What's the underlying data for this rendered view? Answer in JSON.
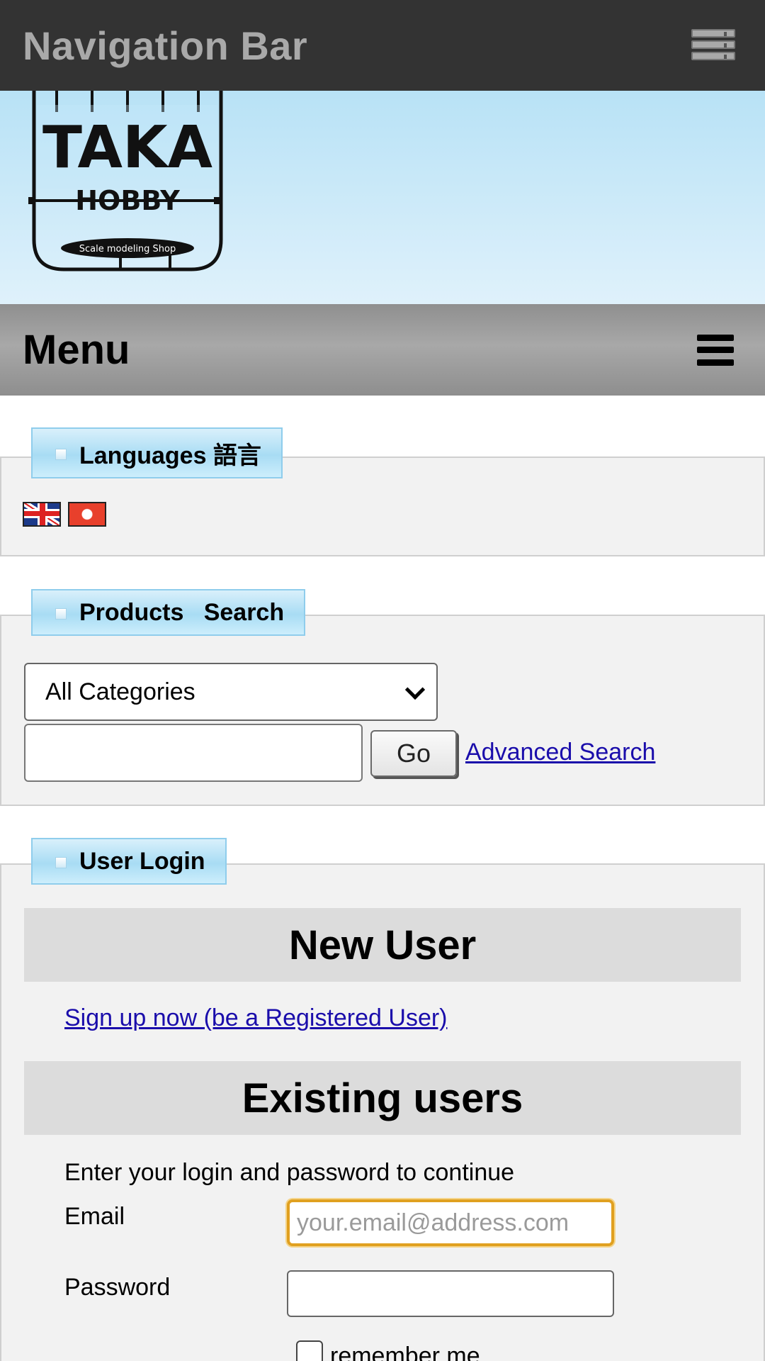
{
  "navbar": {
    "title": "Navigation Bar",
    "toggle_icon": "server-stack-icon"
  },
  "logo": {
    "text_main": "TAKA",
    "text_sub": "HOBBY",
    "text_tag": "Scale modeling Shop"
  },
  "menu": {
    "title": "Menu",
    "icon": "hamburger-icon"
  },
  "languages": {
    "heading": "Languages 語言",
    "flags": [
      "English",
      "Chinese"
    ]
  },
  "products_search": {
    "heading": "Products   Search",
    "category_select": "All Categories",
    "go_label": "Go",
    "advanced_label": "Advanced Search"
  },
  "user_login": {
    "heading": "User Login",
    "new_user_title": "New User",
    "signup_label": "Sign up now (be a Registered User)",
    "existing_title": "Existing users",
    "intro": "Enter your login and password to continue",
    "email_label": "Email",
    "email_placeholder": "your.email@address.com",
    "password_label": "Password",
    "remember_label": "remember me"
  },
  "colors": {
    "navbar_bg": "#333333",
    "navbar_text": "#a9a9a9",
    "header_bg": "#b8e2f6",
    "link": "#1a0dab",
    "focus_border": "#e0a020"
  }
}
